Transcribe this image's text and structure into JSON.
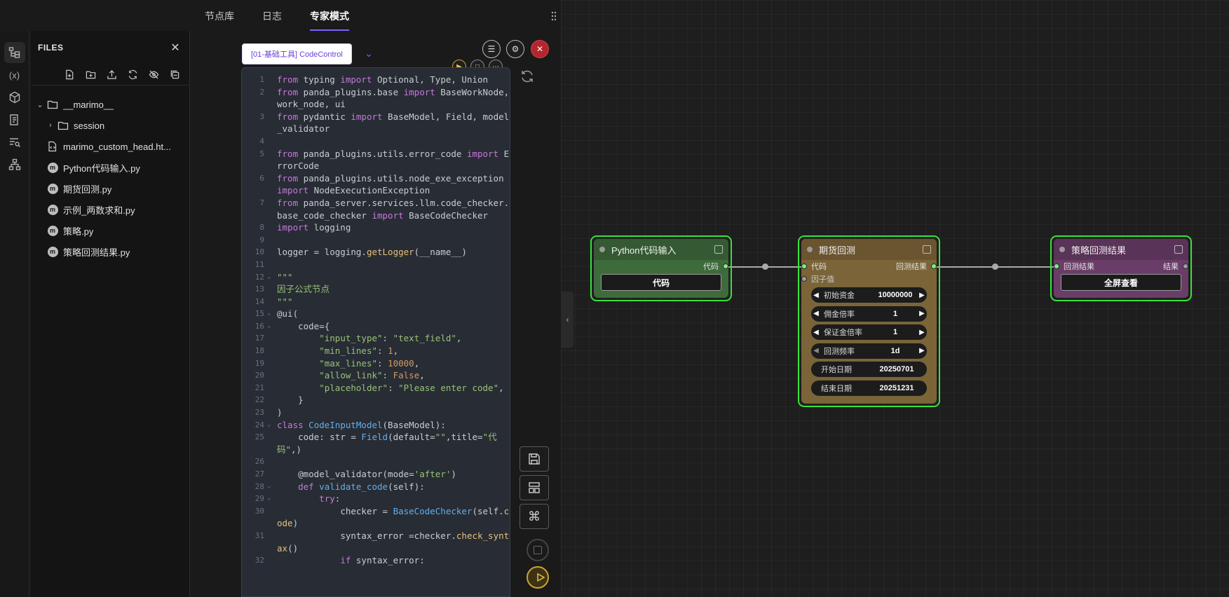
{
  "tabs": [
    "节点库",
    "日志",
    "专家模式"
  ],
  "files": {
    "title": "FILES",
    "tree": [
      {
        "label": "__marimo__",
        "type": "folder-open"
      },
      {
        "label": "session",
        "type": "folder"
      },
      {
        "label": "marimo_custom_head.ht...",
        "type": "html"
      },
      {
        "label": "Python代码输入.py",
        "type": "py"
      },
      {
        "label": "期货回测.py",
        "type": "py"
      },
      {
        "label": "示例_两数求和.py",
        "type": "py"
      },
      {
        "label": "策略.py",
        "type": "py"
      },
      {
        "label": "策略回测结果.py",
        "type": "py"
      }
    ]
  },
  "editor": {
    "node_tag": "[01-基础工具] CodeControl",
    "lines": [
      {
        "n": "1",
        "html": "<span class=\"kw\">from</span> typing <span class=\"kw\">import</span> Optional, Type, Union"
      },
      {
        "n": "2",
        "html": "<span class=\"kw\">from</span> panda_plugins.base <span class=\"kw\">import</span> BaseWorkNode, work_node, ui"
      },
      {
        "n": "3",
        "html": "<span class=\"kw\">from</span> pydantic <span class=\"kw\">import</span> BaseModel, Field, model_validator"
      },
      {
        "n": "4",
        "html": ""
      },
      {
        "n": "5",
        "html": "<span class=\"kw\">from</span> panda_plugins.utils.error_code <span class=\"kw\">import</span> ErrorCode"
      },
      {
        "n": "6",
        "html": "<span class=\"kw\">from</span> panda_plugins.utils.node_exe_exception <span class=\"kw\">import</span> NodeExecutionException"
      },
      {
        "n": "7",
        "html": "<span class=\"kw\">from</span> panda_server.services.llm.code_checker.base_code_checker <span class=\"kw\">import</span> BaseCodeChecker"
      },
      {
        "n": "8",
        "html": "<span class=\"kw\">import</span> logging"
      },
      {
        "n": "9",
        "html": ""
      },
      {
        "n": "10",
        "html": "logger = logging.<span class=\"fn\" style=\"color:#e5c07b\">getLogger</span>(__name__)"
      },
      {
        "n": "11",
        "html": ""
      },
      {
        "n": "12",
        "fold": true,
        "html": "<span class=\"str\">\"\"\"</span>"
      },
      {
        "n": "13",
        "html": "<span class=\"str\">因子公式节点</span>"
      },
      {
        "n": "14",
        "html": "<span class=\"str\">\"\"\"</span>"
      },
      {
        "n": "15",
        "fold": true,
        "html": "@ui("
      },
      {
        "n": "16",
        "fold": true,
        "html": "    code={"
      },
      {
        "n": "17",
        "html": "        <span class=\"str\">\"input_type\"</span>: <span class=\"str\">\"text_field\"</span>,"
      },
      {
        "n": "18",
        "html": "        <span class=\"str\">\"min_lines\"</span>: <span class=\"num\">1</span>,"
      },
      {
        "n": "19",
        "html": "        <span class=\"str\">\"max_lines\"</span>: <span class=\"num\">10000</span>,"
      },
      {
        "n": "20",
        "html": "        <span class=\"str\">\"allow_link\"</span>: <span class=\"num\">False</span>,"
      },
      {
        "n": "21",
        "html": "        <span class=\"str\">\"placeholder\"</span>: <span class=\"str\">\"Please enter code\"</span>,"
      },
      {
        "n": "22",
        "html": "    }"
      },
      {
        "n": "23",
        "html": ")"
      },
      {
        "n": "24",
        "fold": true,
        "html": "<span class=\"kw\">class</span> <span class=\"fn\">CodeInputModel</span>(BaseModel):"
      },
      {
        "n": "25",
        "html": "    code: str = <span class=\"fn\">Field</span>(default=<span class=\"str\">\"\"</span>,title=<span class=\"str\">\"代码\"</span>,)"
      },
      {
        "n": "26",
        "html": ""
      },
      {
        "n": "27",
        "html": "    @model_validator(mode=<span class=\"str\">'after'</span>)"
      },
      {
        "n": "28",
        "fold": true,
        "html": "    <span class=\"kw\">def</span> <span class=\"fn\">validate_code</span>(self):"
      },
      {
        "n": "29",
        "fold": true,
        "html": "        <span class=\"kw\">try</span>:"
      },
      {
        "n": "30",
        "html": "            checker = <span class=\"fn\">BaseCodeChecker</span>(self.<span style=\"color:#e5c07b\">code</span>)"
      },
      {
        "n": "31",
        "html": "            syntax_error =checker.<span style=\"color:#e5c07b\">check_syntax</span>()"
      },
      {
        "n": "32",
        "html": "            <span class=\"kw\">if</span> syntax_error:"
      }
    ]
  },
  "nodes": {
    "python_input": {
      "title": "Python代码输入",
      "out_port": "代码",
      "button": "代码"
    },
    "futures_backtest": {
      "title": "期货回测",
      "in_ports": [
        "代码",
        "因子值"
      ],
      "out_port": "回测结果",
      "params": [
        {
          "label": "初始资金",
          "value": "10000000"
        },
        {
          "label": "佣金倍率",
          "value": "1"
        },
        {
          "label": "保证金倍率",
          "value": "1"
        },
        {
          "label": "回测频率",
          "value": "1d"
        }
      ],
      "dates": [
        {
          "label": "开始日期",
          "value": "20250701"
        },
        {
          "label": "结束日期",
          "value": "20251231"
        }
      ]
    },
    "result": {
      "title": "策略回测结果",
      "in_port": "回测结果",
      "out_port": "结果",
      "button": "全屏查看"
    }
  },
  "colors": {
    "accent": "#7b61ff",
    "node_border": "#39e13b",
    "node_green": "#3e6b3b",
    "node_brown": "#7a6438",
    "node_purple": "#6a3d68"
  }
}
